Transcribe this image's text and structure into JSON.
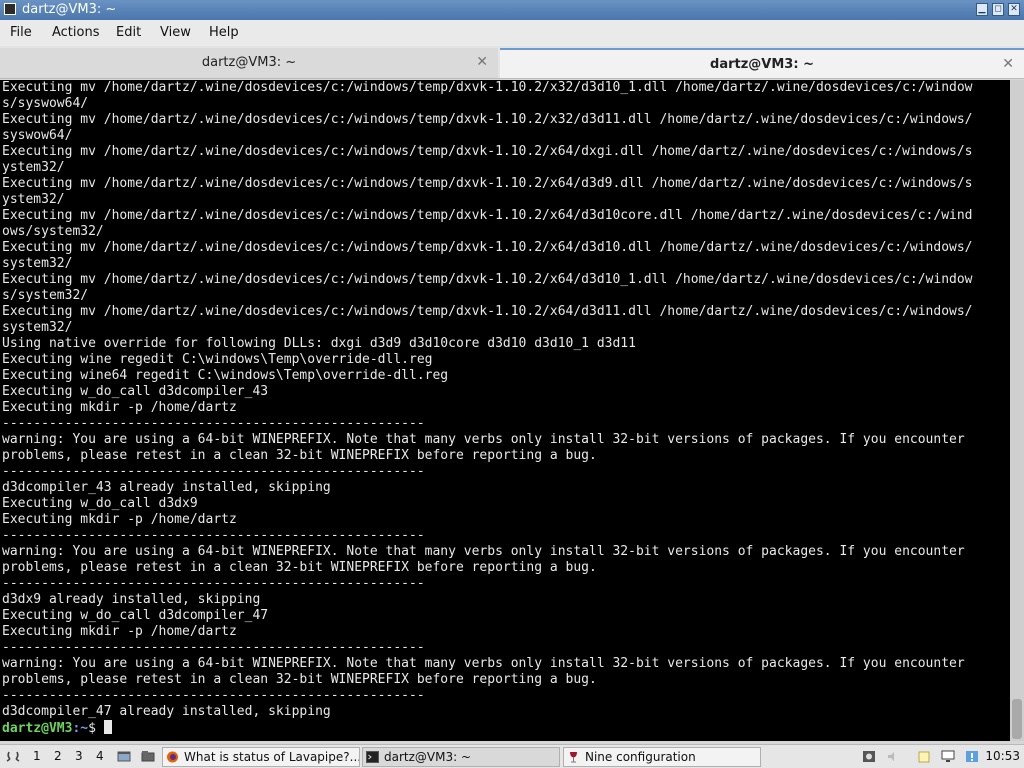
{
  "window": {
    "title": "dartz@VM3: ~"
  },
  "menu": [
    {
      "label": "File"
    },
    {
      "label": "Actions"
    },
    {
      "label": "Edit"
    },
    {
      "label": "View"
    },
    {
      "label": "Help"
    }
  ],
  "tabs": [
    {
      "label": "dartz@VM3: ~",
      "active": false
    },
    {
      "label": "dartz@VM3: ~",
      "active": true
    }
  ],
  "terminal": {
    "lines": [
      "Executing mv /home/dartz/.wine/dosdevices/c:/windows/temp/dxvk-1.10.2/x32/d3d10_1.dll /home/dartz/.wine/dosdevices/c:/window",
      "s/syswow64/",
      "Executing mv /home/dartz/.wine/dosdevices/c:/windows/temp/dxvk-1.10.2/x32/d3d11.dll /home/dartz/.wine/dosdevices/c:/windows/",
      "syswow64/",
      "Executing mv /home/dartz/.wine/dosdevices/c:/windows/temp/dxvk-1.10.2/x64/dxgi.dll /home/dartz/.wine/dosdevices/c:/windows/s",
      "ystem32/",
      "Executing mv /home/dartz/.wine/dosdevices/c:/windows/temp/dxvk-1.10.2/x64/d3d9.dll /home/dartz/.wine/dosdevices/c:/windows/s",
      "ystem32/",
      "Executing mv /home/dartz/.wine/dosdevices/c:/windows/temp/dxvk-1.10.2/x64/d3d10core.dll /home/dartz/.wine/dosdevices/c:/wind",
      "ows/system32/",
      "Executing mv /home/dartz/.wine/dosdevices/c:/windows/temp/dxvk-1.10.2/x64/d3d10.dll /home/dartz/.wine/dosdevices/c:/windows/",
      "system32/",
      "Executing mv /home/dartz/.wine/dosdevices/c:/windows/temp/dxvk-1.10.2/x64/d3d10_1.dll /home/dartz/.wine/dosdevices/c:/window",
      "s/system32/",
      "Executing mv /home/dartz/.wine/dosdevices/c:/windows/temp/dxvk-1.10.2/x64/d3d11.dll /home/dartz/.wine/dosdevices/c:/windows/",
      "system32/",
      "Using native override for following DLLs: dxgi d3d9 d3d10core d3d10 d3d10_1 d3d11",
      "Executing wine regedit C:\\windows\\Temp\\override-dll.reg",
      "Executing wine64 regedit C:\\windows\\Temp\\override-dll.reg",
      "Executing w_do_call d3dcompiler_43",
      "Executing mkdir -p /home/dartz",
      "------------------------------------------------------",
      "warning: You are using a 64-bit WINEPREFIX. Note that many verbs only install 32-bit versions of packages. If you encounter",
      "problems, please retest in a clean 32-bit WINEPREFIX before reporting a bug.",
      "------------------------------------------------------",
      "d3dcompiler_43 already installed, skipping",
      "Executing w_do_call d3dx9",
      "Executing mkdir -p /home/dartz",
      "------------------------------------------------------",
      "warning: You are using a 64-bit WINEPREFIX. Note that many verbs only install 32-bit versions of packages. If you encounter",
      "problems, please retest in a clean 32-bit WINEPREFIX before reporting a bug.",
      "------------------------------------------------------",
      "d3dx9 already installed, skipping",
      "Executing w_do_call d3dcompiler_47",
      "Executing mkdir -p /home/dartz",
      "------------------------------------------------------",
      "warning: You are using a 64-bit WINEPREFIX. Note that many verbs only install 32-bit versions of packages. If you encounter",
      "problems, please retest in a clean 32-bit WINEPREFIX before reporting a bug.",
      "------------------------------------------------------",
      "d3dcompiler_47 already installed, skipping"
    ],
    "prompt_user": "dartz@VM3",
    "prompt_path": ":~",
    "prompt_symbol": "$ "
  },
  "taskbar": {
    "workspaces": [
      "1",
      "2",
      "3",
      "4"
    ],
    "tasks": [
      {
        "label": "What is status of Lavapipe?...",
        "icon": "firefox-icon"
      },
      {
        "label": "dartz@VM3: ~",
        "icon": "terminal-icon"
      },
      {
        "label": "Nine configuration",
        "icon": "wine-icon"
      }
    ],
    "clock": "10:53"
  },
  "colors": {
    "titlebar": "#4a76ad",
    "terminal_bg": "#000000",
    "terminal_fg": "#e8e8e8",
    "prompt_user": "#6bd45a",
    "prompt_path": "#6f9ee8"
  }
}
